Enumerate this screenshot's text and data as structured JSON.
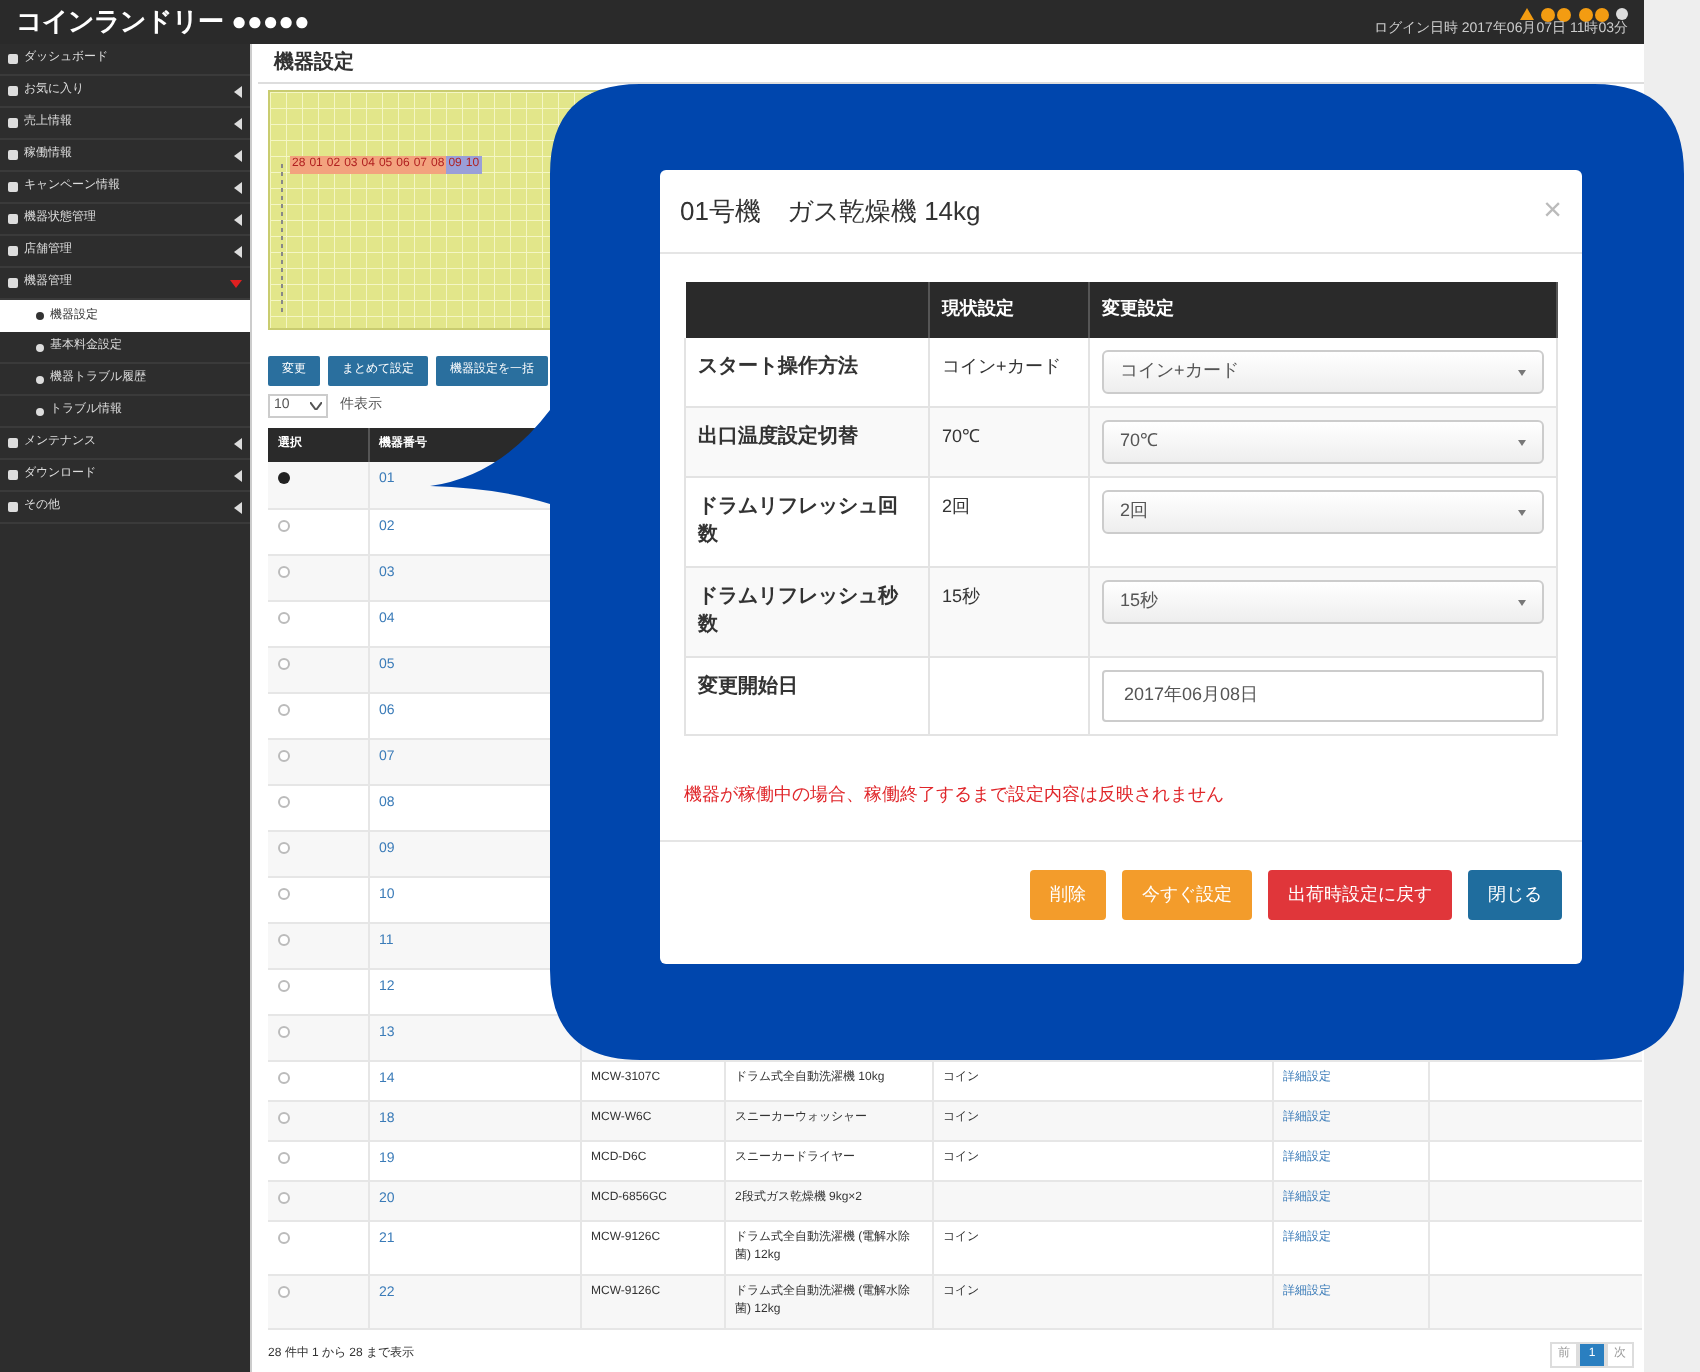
{
  "header": {
    "app_title": "コインランドリー ●●●●●",
    "login_info": "ログイン日時 2017年06月07日 11時03分"
  },
  "sidebar": {
    "items": [
      {
        "label": "ダッシュボード"
      },
      {
        "label": "お気に入り",
        "expanded": false
      },
      {
        "label": "売上情報",
        "expanded": false
      },
      {
        "label": "稼働情報",
        "expanded": false
      },
      {
        "label": "キャンペーン情報",
        "expanded": false
      },
      {
        "label": "機器状態管理",
        "expanded": false
      },
      {
        "label": "店舗管理",
        "expanded": false
      },
      {
        "label": "機器管理",
        "expanded": true,
        "children": [
          {
            "label": "機器設定",
            "selected": true
          },
          {
            "label": "基本料金設定",
            "selected": false
          },
          {
            "label": "機器トラブル履歴",
            "selected": false
          },
          {
            "label": "トラブル情報",
            "selected": false
          }
        ]
      },
      {
        "label": "メンテナンス",
        "expanded": false
      },
      {
        "label": "ダウンロード",
        "expanded": false
      },
      {
        "label": "その他",
        "expanded": false
      }
    ]
  },
  "page_title": "機器設定",
  "timeline": {
    "days": [
      {
        "label": "28",
        "color": "#f3a37e"
      },
      {
        "label": "01",
        "color": "#f3a37e"
      },
      {
        "label": "02",
        "color": "#f3a37e"
      },
      {
        "label": "03",
        "color": "#f3a37e"
      },
      {
        "label": "04",
        "color": "#f3a37e"
      },
      {
        "label": "05",
        "color": "#f3a37e"
      },
      {
        "label": "06",
        "color": "#f3a37e"
      },
      {
        "label": "07",
        "color": "#f3a37e"
      },
      {
        "label": "08",
        "color": "#f3a37e"
      },
      {
        "label": "09",
        "color": "#9a9fd8"
      },
      {
        "label": "10",
        "color": "#9a9fd8"
      }
    ]
  },
  "toolbar": {
    "buttons": [
      "変更",
      "まとめて設定",
      "機器設定を一括"
    ]
  },
  "page_size": {
    "value": "10",
    "label": "件表示"
  },
  "table": {
    "columns": [
      "選択",
      "機器番号"
    ],
    "rows": [
      {
        "selected": true,
        "number": "01"
      },
      {
        "selected": false,
        "number": "02"
      },
      {
        "selected": false,
        "number": "03"
      },
      {
        "selected": false,
        "number": "04"
      },
      {
        "selected": false,
        "number": "05"
      },
      {
        "selected": false,
        "number": "06"
      },
      {
        "selected": false,
        "number": "07"
      },
      {
        "selected": false,
        "number": "08"
      },
      {
        "selected": false,
        "number": "09"
      },
      {
        "selected": false,
        "number": "10"
      },
      {
        "selected": false,
        "number": "11"
      },
      {
        "selected": false,
        "number": "12"
      },
      {
        "selected": false,
        "number": "13"
      },
      {
        "selected": false,
        "number": "14",
        "model": "MCW-3107C",
        "name": "ドラム式全自動洗濯機 10kg",
        "payment": "コイン",
        "link": "詳細設定"
      },
      {
        "selected": false,
        "number": "18",
        "model": "MCW-W6C",
        "name": "スニーカーウォッシャー",
        "payment": "コイン",
        "link": "詳細設定"
      },
      {
        "selected": false,
        "number": "19",
        "model": "MCD-D6C",
        "name": "スニーカードライヤー",
        "payment": "コイン",
        "link": "詳細設定"
      },
      {
        "selected": false,
        "number": "20",
        "model": "MCD-6856GC",
        "name": "2段式ガス乾燥機 9kg×2",
        "link": "詳細設定"
      },
      {
        "selected": false,
        "number": "21",
        "model": "MCW-9126C",
        "name": "ドラム式全自動洗濯機 (電解水除菌) 12kg",
        "payment": "コイン",
        "link": "詳細設定"
      },
      {
        "selected": false,
        "number": "22",
        "model": "MCW-9126C",
        "name": "ドラム式全自動洗濯機 (電解水除菌) 12kg",
        "payment": "コイン",
        "link": "詳細設定"
      }
    ]
  },
  "footer": {
    "summary": "28 件中 1 から 28 まで表示",
    "pages": [
      {
        "label": "前",
        "selected": false
      },
      {
        "label": "1",
        "selected": true
      },
      {
        "label": "次",
        "selected": false
      }
    ]
  },
  "modal": {
    "title": "01号機　ガス乾燥機 14kg",
    "close": "×",
    "columns": [
      "現状設定",
      "変更設定"
    ],
    "rows": [
      {
        "label": "スタート操作方法",
        "current": "コイン+カード",
        "kind": "select",
        "value": "コイン+カード"
      },
      {
        "label": "出口温度設定切替",
        "current": "70℃",
        "kind": "select",
        "value": "70℃"
      },
      {
        "label": "ドラムリフレッシュ回数",
        "current": "2回",
        "kind": "select",
        "value": "2回"
      },
      {
        "label": "ドラムリフレッシュ秒数",
        "current": "15秒",
        "kind": "select",
        "value": "15秒"
      },
      {
        "label": "変更開始日",
        "kind": "input",
        "value": "2017年06月08日"
      }
    ],
    "note": "機器が稼働中の場合、稼働終了するまで設定内容は反映されません",
    "buttons": [
      {
        "label": "削除",
        "color": "#f39c2b"
      },
      {
        "label": "今すぐ設定",
        "color": "#f39c2b"
      },
      {
        "label": "出荷時設定に戻す",
        "color": "#e0363a"
      },
      {
        "label": "閉じる",
        "color": "#1f6d9e"
      }
    ]
  }
}
